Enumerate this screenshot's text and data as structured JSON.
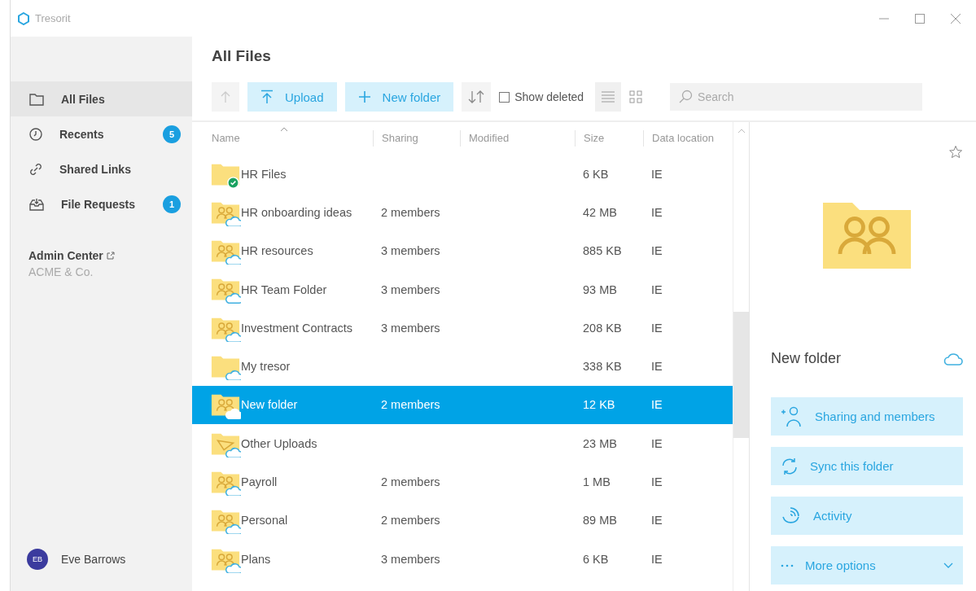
{
  "window": {
    "title": "Tresorit"
  },
  "sidebar": {
    "items": [
      {
        "label": "All Files",
        "kind": "folder",
        "selected": true
      },
      {
        "label": "Recents",
        "kind": "recent",
        "badge": "5",
        "selected": false
      },
      {
        "label": "Shared Links",
        "kind": "link",
        "selected": false
      },
      {
        "label": "File Requests",
        "kind": "request",
        "badge": "1",
        "selected": false
      }
    ],
    "admin": {
      "label": "Admin Center",
      "org": "ACME & Co."
    },
    "user": {
      "initials": "EB",
      "name": "Eve Barrows"
    }
  },
  "main": {
    "title": "All Files",
    "toolbar": {
      "upload": "Upload",
      "new_folder": "New folder",
      "show_deleted": {
        "label": "Show deleted",
        "checked": false
      },
      "views": [
        {
          "kind": "list",
          "selected": true
        },
        {
          "kind": "grid",
          "selected": false
        }
      ],
      "search": {
        "placeholder": "Search"
      }
    },
    "table": {
      "columns": [
        "Name",
        "Sharing",
        "Modified",
        "Size",
        "Data location"
      ],
      "rows": [
        {
          "name": "HR Files",
          "kind": "plain",
          "synced": true,
          "size": "6 KB",
          "location": "IE",
          "selected": false
        },
        {
          "name": "HR onboarding ideas",
          "kind": "shared",
          "synced": false,
          "sharing": "2 members",
          "size": "42 MB",
          "location": "IE",
          "selected": false
        },
        {
          "name": "HR resources",
          "kind": "shared",
          "synced": false,
          "sharing": "3 members",
          "size": "885 KB",
          "location": "IE",
          "selected": false
        },
        {
          "name": "HR Team Folder",
          "kind": "shared",
          "synced": false,
          "sharing": "3 members",
          "size": "93 MB",
          "location": "IE",
          "selected": false
        },
        {
          "name": "Investment Contracts",
          "kind": "shared",
          "synced": false,
          "sharing": "3 members",
          "size": "208 KB",
          "location": "IE",
          "selected": false
        },
        {
          "name": "My tresor",
          "kind": "plain",
          "synced": false,
          "size": "338 KB",
          "location": "IE",
          "selected": false
        },
        {
          "name": "New folder",
          "kind": "shared",
          "synced": false,
          "sharing": "2 members",
          "size": "12 KB",
          "location": "IE",
          "selected": true
        },
        {
          "name": "Other Uploads",
          "kind": "upload",
          "synced": false,
          "size": "23 MB",
          "location": "IE",
          "selected": false
        },
        {
          "name": "Payroll",
          "kind": "shared",
          "synced": false,
          "sharing": "2 members",
          "size": "1 MB",
          "location": "IE",
          "selected": false
        },
        {
          "name": "Personal",
          "kind": "shared",
          "synced": false,
          "sharing": "2 members",
          "size": "89 MB",
          "location": "IE",
          "selected": false
        },
        {
          "name": "Plans",
          "kind": "shared",
          "synced": false,
          "sharing": "3 members",
          "size": "6 KB",
          "location": "IE",
          "selected": false
        }
      ]
    }
  },
  "details": {
    "title": "New folder",
    "kind": "shared",
    "synced": false,
    "actions": [
      {
        "kind": "sharing",
        "label": "Sharing and members"
      },
      {
        "kind": "sync",
        "label": "Sync this folder"
      },
      {
        "kind": "activity",
        "label": "Activity"
      },
      {
        "kind": "more",
        "label": "More options"
      }
    ]
  }
}
